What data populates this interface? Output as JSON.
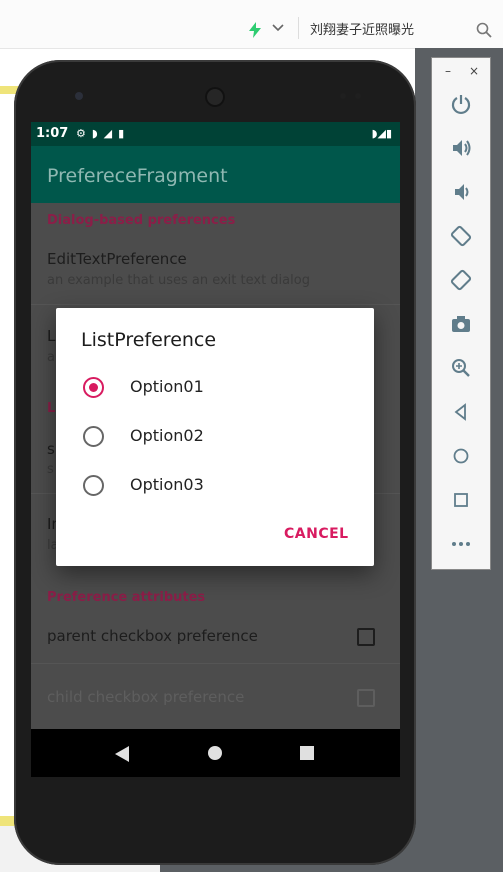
{
  "browser": {
    "search_text": "刘翔妻子近照曝光"
  },
  "emulator_controls": {
    "minimize_label": "–",
    "close_label": "×",
    "buttons": [
      "power-icon",
      "volume-up-icon",
      "volume-down-icon",
      "rotate-left-icon",
      "rotate-right-icon",
      "camera-icon",
      "zoom-icon",
      "back-icon",
      "home-icon",
      "overview-icon",
      "more-icon"
    ]
  },
  "status_bar": {
    "time": "1:07"
  },
  "app_bar": {
    "title": "PreferecеFragment"
  },
  "preferences": {
    "cat_dialog": "Dialog-based preferences",
    "edit_text_title": "EditTextPreference",
    "edit_text_summary": "an example that uses an exit text dialog",
    "list_title_partial": "L",
    "list_summary_partial": "a",
    "cat_launch_partial": "L",
    "screen_title_partial": "s",
    "screen_summary_partial": "s",
    "intent_title_partial": "In",
    "intent_summary_partial": "la",
    "cat_attributes": "Preference attributes",
    "parent_checkbox": "parent checkbox preference",
    "child_checkbox": "child checkbox preference"
  },
  "dialog": {
    "title": "ListPreference",
    "options": [
      {
        "label": "Option01",
        "selected": true
      },
      {
        "label": "Option02",
        "selected": false
      },
      {
        "label": "Option03",
        "selected": false
      }
    ],
    "cancel_label": "CANCEL"
  },
  "colors": {
    "accent": "#d81b60",
    "primary_dark": "#004236",
    "primary": "#00574b"
  }
}
